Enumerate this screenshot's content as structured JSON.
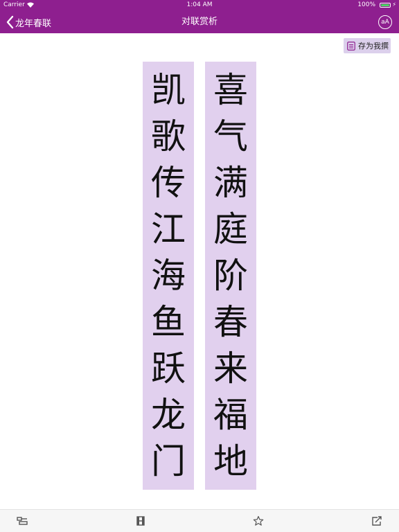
{
  "status_bar": {
    "carrier": "Carrier",
    "time": "1:04 AM",
    "battery": "100%",
    "battery_level": 1.0
  },
  "nav": {
    "back_label": "龙年春联",
    "title": "对联赏析",
    "font_button_label": "aA"
  },
  "actions": {
    "save_label": "存为我撰"
  },
  "couplet": {
    "left": [
      "凯",
      "歌",
      "传",
      "江",
      "海",
      "鱼",
      "跃",
      "龙",
      "门"
    ],
    "right": [
      "喜",
      "气",
      "满",
      "庭",
      "阶",
      "春",
      "来",
      "福",
      "地"
    ]
  },
  "colors": {
    "nav_background": "#8e1f8f",
    "scroll_background": "#e1d0ee",
    "save_background": "#dcd0ec",
    "toolbar_background": "#f6f6f6"
  },
  "icons": {
    "back": "chevron-left-icon",
    "font": "font-size-icon",
    "save": "document-icon",
    "toolbar": [
      "list-icon",
      "film-icon",
      "star-icon",
      "share-icon"
    ]
  }
}
